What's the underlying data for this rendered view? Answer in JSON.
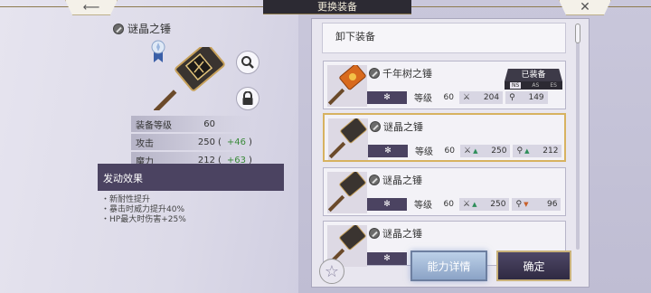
{
  "header": {
    "title": "更换装备",
    "back_icon": "arrow-left-icon",
    "close_icon": "close-icon"
  },
  "detail": {
    "name": "谜晶之锤",
    "stats": [
      {
        "label": "装备等级",
        "value": "60",
        "bonus": ""
      },
      {
        "label": "攻击",
        "value": "250",
        "bonus": "+46"
      },
      {
        "label": "魔力",
        "value": "212",
        "bonus": "+63"
      }
    ],
    "paren_open": "(",
    "paren_close": ")",
    "effect_title": "发动效果",
    "effects": [
      "・新耐性提升",
      "・暴击时威力提升40%",
      "・HP最大时伤害+25%"
    ]
  },
  "list": {
    "unequip_label": "卸下装备",
    "level_label": "等级",
    "star_glyph": "✻",
    "cards": [
      {
        "name": "千年树之锤",
        "level": "60",
        "atk": "204",
        "atk_trend": "",
        "mag": "149",
        "mag_trend": "",
        "equipped": true
      },
      {
        "name": "谜晶之锤",
        "level": "60",
        "atk": "250",
        "atk_trend": "▲",
        "mag": "212",
        "mag_trend": "▲",
        "selected": true
      },
      {
        "name": "谜晶之锤",
        "level": "60",
        "atk": "250",
        "atk_trend": "▲",
        "mag": "96",
        "mag_trend": "▼"
      },
      {
        "name": "谜晶之锤",
        "level": "",
        "atk": "",
        "atk_trend": "",
        "mag": "",
        "mag_trend": ""
      }
    ],
    "equipped_badge": "已装备",
    "equipped_tags": [
      "NS",
      "AS",
      "ES"
    ]
  },
  "buttons": {
    "detail": "能力详情",
    "confirm": "确定"
  },
  "colors": {
    "accent_gold": "#d7b260",
    "panel_dark": "#4b4361",
    "up": "#2e8e5a",
    "down": "#c8602a"
  }
}
